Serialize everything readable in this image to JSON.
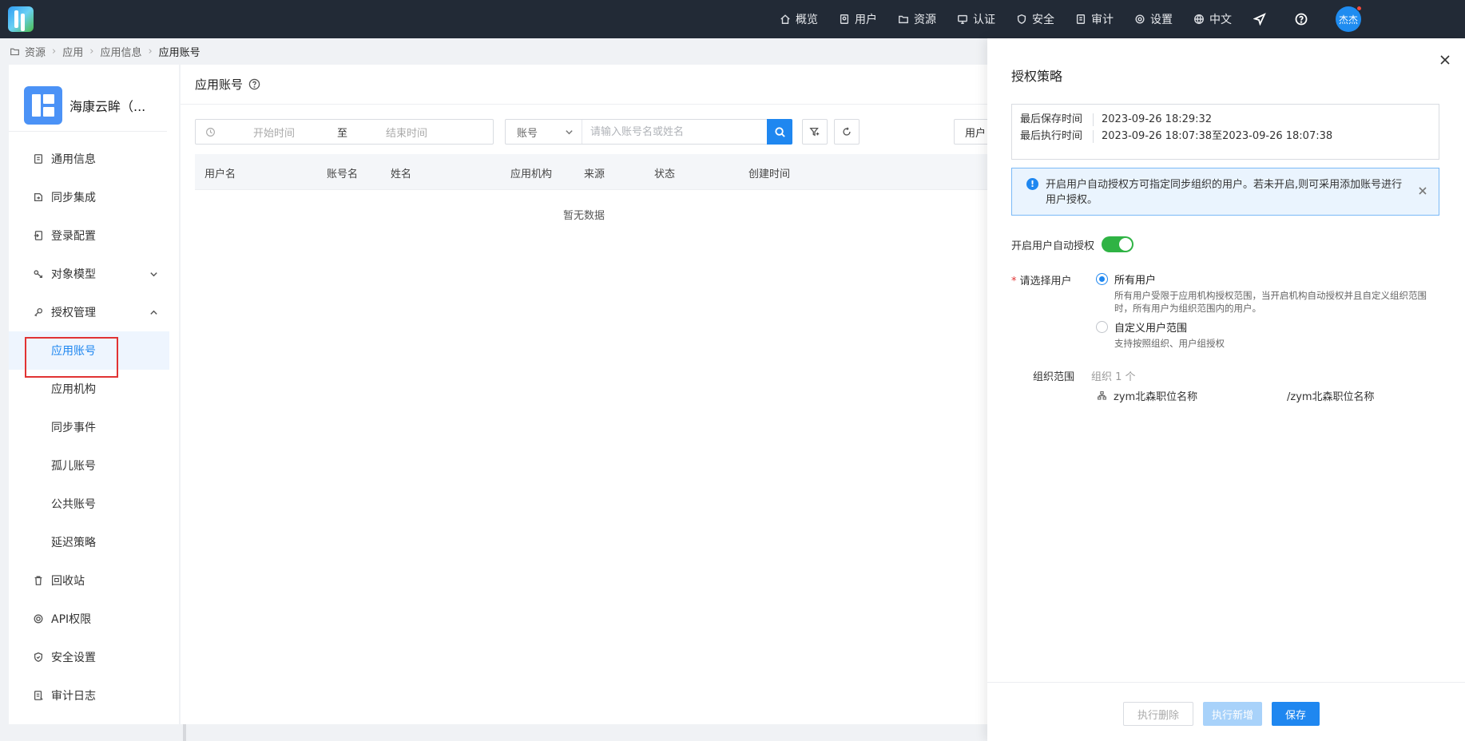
{
  "topnav": {
    "items": [
      {
        "label": "概览",
        "icon": "home-icon"
      },
      {
        "label": "用户",
        "icon": "user-icon"
      },
      {
        "label": "资源",
        "icon": "folder-icon"
      },
      {
        "label": "认证",
        "icon": "monitor-icon"
      },
      {
        "label": "安全",
        "icon": "shield-icon"
      },
      {
        "label": "审计",
        "icon": "file-icon"
      },
      {
        "label": "设置",
        "icon": "gear-icon"
      },
      {
        "label": "中文",
        "icon": "globe-icon"
      }
    ],
    "avatar_text": "杰杰",
    "colors": {
      "bar": "#222a36",
      "avatar": "#1f8cf0",
      "notify_dot": "#f5483b"
    }
  },
  "breadcrumb": [
    "资源",
    "应用",
    "应用信息",
    "应用账号"
  ],
  "sidebar": {
    "app_name": "海康云眸（...",
    "items": [
      {
        "label": "通用信息",
        "icon": "doc-icon"
      },
      {
        "label": "同步集成",
        "icon": "sync-icon"
      },
      {
        "label": "登录配置",
        "icon": "login-icon"
      },
      {
        "label": "对象模型",
        "icon": "model-icon"
      },
      {
        "label": "授权管理",
        "icon": "key-icon"
      }
    ],
    "sub_items": [
      "应用账号",
      "应用机构",
      "同步事件",
      "孤儿账号",
      "公共账号",
      "延迟策略"
    ],
    "bottom_items": [
      {
        "label": "回收站",
        "icon": "trash-icon"
      },
      {
        "label": "API权限",
        "icon": "api-icon"
      },
      {
        "label": "安全设置",
        "icon": "shield-icon"
      },
      {
        "label": "审计日志",
        "icon": "log-icon"
      }
    ],
    "active_color": "#1f87f0"
  },
  "main": {
    "title": "应用账号",
    "date_start_placeholder": "开始时间",
    "date_to": "至",
    "date_end_placeholder": "结束时间",
    "search_field": "账号",
    "search_placeholder": "请输入账号名或姓名",
    "user_type_button": "用户",
    "columns": [
      "用户名",
      "账号名",
      "姓名",
      "应用机构",
      "来源",
      "状态",
      "创建时间"
    ],
    "empty_text": "暂无数据"
  },
  "drawer": {
    "title": "授权策略",
    "last_saved_label": "最后保存时间",
    "last_saved_value": "2023-09-26 18:29:32",
    "last_exec_label": "最后执行时间",
    "last_exec_value": "2023-09-26 18:07:38至2023-09-26 18:07:38",
    "alert_text": "开启用户自动授权方可指定同步组织的用户。若未开启,则可采用添加账号进行用户授权。",
    "switch_label": "开启用户自动授权",
    "switch_on": true,
    "select_user_label": "请选择用户",
    "options": [
      {
        "label": "所有用户",
        "desc": "所有用户受限于应用机构授权范围，当开启机构自动授权并且自定义组织范围时，所有用户为组织范围内的用户。",
        "selected": true
      },
      {
        "label": "自定义用户范围",
        "desc": "支持按照组织、用户组授权",
        "selected": false
      }
    ],
    "scope_label": "组织范围",
    "scope_count": "组织 1 个",
    "scope_org_name": "zym北森职位名称",
    "scope_org_path": "/zym北森职位名称",
    "buttons": {
      "delete": "执行删除",
      "add": "执行新增",
      "save": "保存"
    },
    "colors": {
      "switch": "#2fb344",
      "primary": "#1f87f0",
      "primary_disabled": "#a8d2fa",
      "alert_bg": "#eaf4fe"
    }
  }
}
